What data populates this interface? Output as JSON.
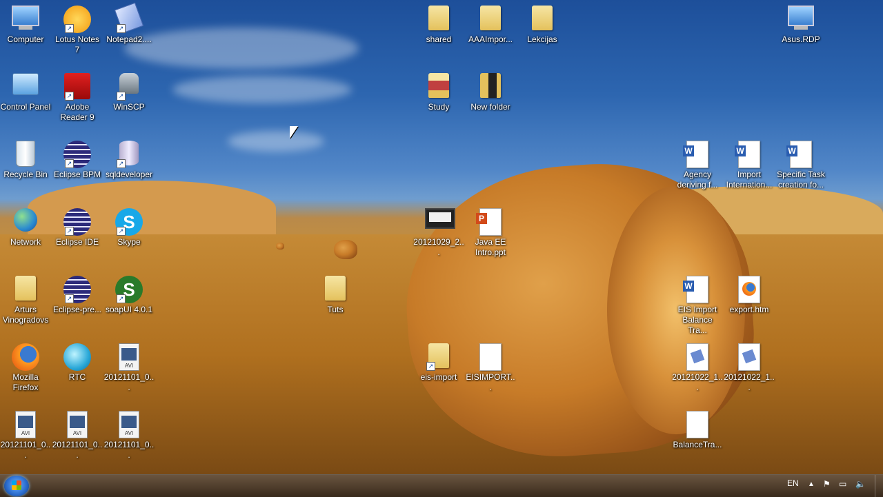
{
  "desktop": {
    "icons": [
      {
        "label": "Computer",
        "icon": "computer-icon"
      },
      {
        "label": "Lotus Notes 7",
        "icon": "lotus-notes-icon"
      },
      {
        "label": "Notepad2....",
        "icon": "notepad2-icon"
      },
      {
        "label": "Control Panel",
        "icon": "control-panel-icon"
      },
      {
        "label": "Adobe Reader 9",
        "icon": "adobe-reader-icon"
      },
      {
        "label": "WinSCP",
        "icon": "winscp-icon"
      },
      {
        "label": "Recycle Bin",
        "icon": "recycle-bin-icon"
      },
      {
        "label": "Eclipse BPM",
        "icon": "eclipse-icon"
      },
      {
        "label": "sqldeveloper",
        "icon": "sqldeveloper-icon"
      },
      {
        "label": "Network",
        "icon": "network-icon"
      },
      {
        "label": "Eclipse IDE",
        "icon": "eclipse-icon"
      },
      {
        "label": "Skype",
        "icon": "skype-icon"
      },
      {
        "label": "Arturs Vinogradovs",
        "icon": "user-folder-icon"
      },
      {
        "label": "Eclipse-pre...",
        "icon": "eclipse-icon"
      },
      {
        "label": "soapUI 4.0.1",
        "icon": "soapui-icon"
      },
      {
        "label": "Mozilla Firefox",
        "icon": "firefox-icon"
      },
      {
        "label": "RTC",
        "icon": "rtc-icon"
      },
      {
        "label": "20121101_0...",
        "icon": "avi-file-icon"
      },
      {
        "label": "20121101_0...",
        "icon": "avi-file-icon"
      },
      {
        "label": "20121101_0...",
        "icon": "avi-file-icon"
      },
      {
        "label": "20121101_0...",
        "icon": "avi-file-icon"
      },
      {
        "label": "Tuts",
        "icon": "folder-icon"
      },
      {
        "label": "shared",
        "icon": "folder-icon"
      },
      {
        "label": "AAAImpor...",
        "icon": "folder-icon"
      },
      {
        "label": "Lekcijas",
        "icon": "folder-icon"
      },
      {
        "label": "Study",
        "icon": "folder-icon"
      },
      {
        "label": "New folder",
        "icon": "folder-icon"
      },
      {
        "label": "20121029_2...",
        "icon": "video-file-icon"
      },
      {
        "label": "Java EE Intro.ppt",
        "icon": "powerpoint-file-icon"
      },
      {
        "label": "eis-import",
        "icon": "folder-icon"
      },
      {
        "label": "EISIMPORT...",
        "icon": "blank-file-icon"
      },
      {
        "label": "Asus.RDP",
        "icon": "rdp-icon"
      },
      {
        "label": "Agency deriving f...",
        "icon": "word-file-icon"
      },
      {
        "label": "Import Internation...",
        "icon": "word-file-icon"
      },
      {
        "label": "Specific Task creation fo...",
        "icon": "word-file-icon"
      },
      {
        "label": "EIS Import Balance Tra...",
        "icon": "word-file-icon"
      },
      {
        "label": "export.htm",
        "icon": "firefox-html-icon"
      },
      {
        "label": "20121022_1...",
        "icon": "notepad2-file-icon"
      },
      {
        "label": "20121022_1...",
        "icon": "notepad2-file-icon"
      },
      {
        "label": "BalanceTra...",
        "icon": "blank-file-icon"
      }
    ]
  },
  "taskbar": {
    "language": "EN"
  },
  "colors": {
    "folder": "#e4c15c",
    "word": "#2a5db0",
    "taskbar": "#3a2814"
  }
}
